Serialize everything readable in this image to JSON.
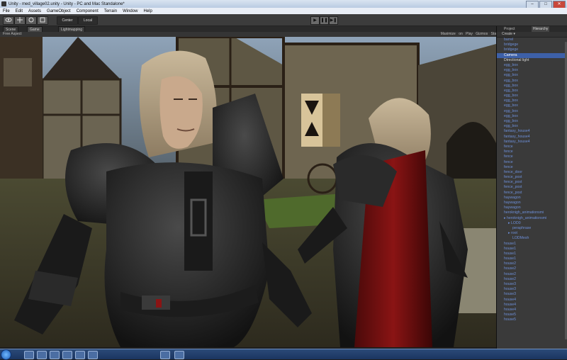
{
  "window": {
    "title": "Unity - med_village02.unity - Unity - PC and Mac Standalone*",
    "buttons": {
      "minimize": "–",
      "maximize": "□",
      "close": "✕"
    }
  },
  "menu": [
    "File",
    "Edit",
    "Assets",
    "GameObject",
    "Component",
    "Terrain",
    "Window",
    "Help"
  ],
  "toolbar": {
    "pivot_label": "Center",
    "space_label": "Local",
    "play": "▶",
    "pause": "❚❚",
    "step": "▶❚"
  },
  "tabs": {
    "scene": "Scene",
    "game": "Game",
    "lightmapping": "Lightmapping"
  },
  "game_toolbar": {
    "aspect": "Free Aspect",
    "options": "Maximize on Play   Gizmos   Stats"
  },
  "right_panel": {
    "project_tab": "Project",
    "hierarchy_tab": "Hierarchy",
    "create_label": "Create ▾",
    "items": [
      {
        "label": "barrel",
        "style": "blue"
      },
      {
        "label": "bridgege",
        "style": "blue"
      },
      {
        "label": "bridgege",
        "style": "blue"
      },
      {
        "label": "Camera",
        "style": "selected"
      },
      {
        "label": "Directional light",
        "style": "white"
      },
      {
        "label": "egg_box",
        "style": "blue"
      },
      {
        "label": "egg_box",
        "style": "blue"
      },
      {
        "label": "egg_box",
        "style": "blue"
      },
      {
        "label": "egg_box",
        "style": "blue"
      },
      {
        "label": "egg_box",
        "style": "blue"
      },
      {
        "label": "egg_box",
        "style": "blue"
      },
      {
        "label": "egg_box",
        "style": "blue"
      },
      {
        "label": "egg_box",
        "style": "blue"
      },
      {
        "label": "egg_box",
        "style": "blue"
      },
      {
        "label": "egg_box",
        "style": "blue"
      },
      {
        "label": "egg_box",
        "style": "blue"
      },
      {
        "label": "egg_box",
        "style": "blue"
      },
      {
        "label": "egg_box",
        "style": "blue"
      },
      {
        "label": "fantasy_house4",
        "style": "blue"
      },
      {
        "label": "fantasy_house4",
        "style": "blue"
      },
      {
        "label": "fantasy_house4",
        "style": "blue"
      },
      {
        "label": "fence",
        "style": "blue"
      },
      {
        "label": "fence",
        "style": "blue"
      },
      {
        "label": "fence",
        "style": "blue"
      },
      {
        "label": "fence",
        "style": "blue"
      },
      {
        "label": "fence",
        "style": "blue"
      },
      {
        "label": "fence_door",
        "style": "blue"
      },
      {
        "label": "fence_post",
        "style": "blue"
      },
      {
        "label": "fence_post",
        "style": "blue"
      },
      {
        "label": "fence_post",
        "style": "blue"
      },
      {
        "label": "fence_post",
        "style": "blue"
      },
      {
        "label": "haywagon",
        "style": "blue"
      },
      {
        "label": "haywagon",
        "style": "blue"
      },
      {
        "label": "haywagon",
        "style": "blue"
      },
      {
        "label": "heroknigh_animationsmi",
        "style": "blue"
      },
      {
        "label": "▸ heroknigh_animationsmi",
        "style": "blue"
      },
      {
        "label": "▸ LOD0",
        "style": "blue-indent"
      },
      {
        "label": "peraphrase",
        "style": "blue-indent2"
      },
      {
        "label": "▸ root",
        "style": "blue-indent"
      },
      {
        "label": "LODMesh",
        "style": "blue-indent2"
      },
      {
        "label": "house1",
        "style": "blue"
      },
      {
        "label": "house1",
        "style": "blue"
      },
      {
        "label": "house1",
        "style": "blue"
      },
      {
        "label": "house1",
        "style": "blue"
      },
      {
        "label": "house2",
        "style": "blue"
      },
      {
        "label": "house2",
        "style": "blue"
      },
      {
        "label": "house2",
        "style": "blue"
      },
      {
        "label": "house2",
        "style": "blue"
      },
      {
        "label": "house3",
        "style": "blue"
      },
      {
        "label": "house3",
        "style": "blue"
      },
      {
        "label": "house3",
        "style": "blue"
      },
      {
        "label": "house4",
        "style": "blue"
      },
      {
        "label": "house4",
        "style": "blue"
      },
      {
        "label": "house4",
        "style": "blue"
      },
      {
        "label": "house5",
        "style": "blue"
      },
      {
        "label": "house5",
        "style": "blue"
      }
    ]
  },
  "colors": {
    "hierarchy_link": "#6d8fd8",
    "selection": "#3d60a8",
    "editor_bg": "#3a3a3a"
  }
}
